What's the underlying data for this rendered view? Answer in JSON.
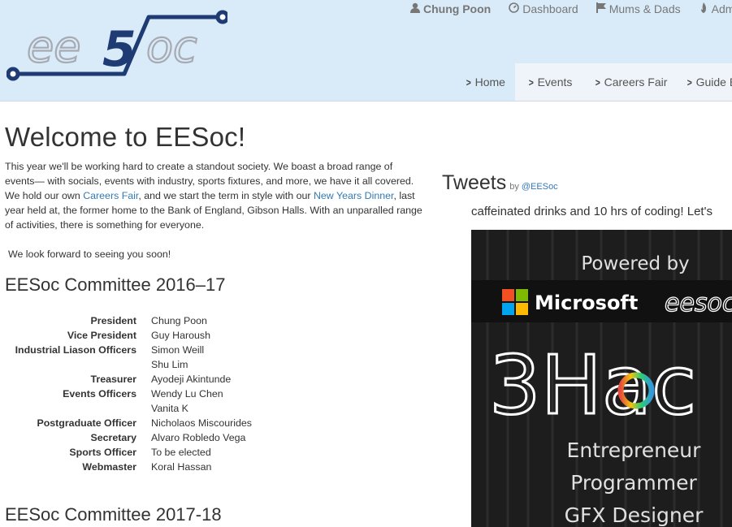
{
  "nav_user": {
    "username": "Chung Poon",
    "items": [
      {
        "label": "Dashboard",
        "icon": "dashboard-icon"
      },
      {
        "label": "Mums & Dads",
        "icon": "flag-icon"
      },
      {
        "label": "Admin",
        "icon": "fire-icon"
      }
    ]
  },
  "brand": {
    "logo": "eesoc"
  },
  "main_nav": [
    {
      "label": "Home",
      "active": true
    },
    {
      "label": "Events"
    },
    {
      "label": "Careers Fair"
    },
    {
      "label": "Guide B"
    }
  ],
  "welcome": {
    "title": "Welcome to EESoc!",
    "p1_a": "This year we'll be working hard to create a standout society. We boast a broad range of events— with socials, events with industry, sports fixtures, and more, we have it all covered. We hold our own ",
    "link_careers": "Careers Fair",
    "p1_b": ", and we start the term in style with our ",
    "link_dinner": "New Years Dinner",
    "p1_c": ", last year held at, the former home to the Bank of England, Gibson Halls. With an unparalled range of activities, there is something for everyone.",
    "p2": "We look forward to seeing you soon!"
  },
  "committee_2016": {
    "heading": "EESoc Committee 2016–17",
    "rows": [
      {
        "role": "President",
        "name": "Chung Poon"
      },
      {
        "role": "Vice President",
        "name": "Guy Haroush"
      },
      {
        "role": "Industrial Liason Officers",
        "name": "Simon Weill"
      },
      {
        "role": "",
        "name": "Shu Lim"
      },
      {
        "role": "Treasurer",
        "name": "Ayodeji Akintunde"
      },
      {
        "role": "Events Officers",
        "name": "Wendy Lu Chen"
      },
      {
        "role": "",
        "name": "Vanita K"
      },
      {
        "role": "Postgraduate Officer",
        "name": "Nicholaos Miscourides"
      },
      {
        "role": "Secretary",
        "name": "Alvaro Robledo Vega"
      },
      {
        "role": "Sports Officer",
        "name": "To be elected"
      },
      {
        "role": "Webmaster",
        "name": "Koral Hassan"
      }
    ]
  },
  "committee_2017": {
    "heading": "EESoc Committee 2017-18"
  },
  "tweets": {
    "title": "Tweets",
    "by": "by",
    "handle": "@EESoc",
    "text": "caffeinated drinks and 10 hrs of coding! Let's",
    "poster": {
      "powered": "Powered by",
      "microsoft": "Microsoft",
      "eesoc": "eesoc",
      "event": "3Hac",
      "roles": [
        "Entrepreneur",
        "Programmer",
        "GFX Designer"
      ]
    }
  }
}
